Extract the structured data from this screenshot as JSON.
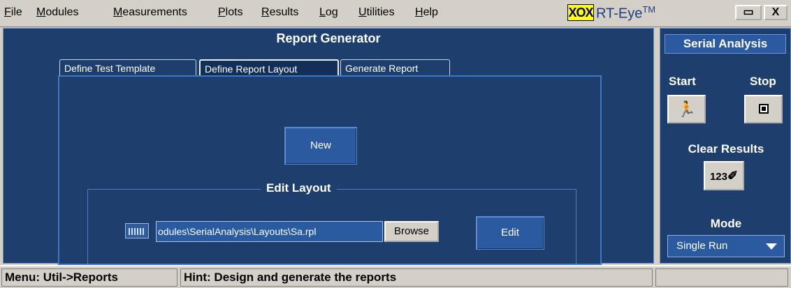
{
  "menu": [
    {
      "pre": "",
      "ul": "F",
      "post": "ile"
    },
    {
      "pre": "",
      "ul": "M",
      "post": "odules"
    },
    {
      "pre": "",
      "ul": "M",
      "post": "easurements"
    },
    {
      "pre": "",
      "ul": "P",
      "post": "lots"
    },
    {
      "pre": "",
      "ul": "R",
      "post": "esults"
    },
    {
      "pre": "",
      "ul": "L",
      "post": "og"
    },
    {
      "pre": "",
      "ul": "U",
      "post": "tilities"
    },
    {
      "pre": "",
      "ul": "H",
      "post": "elp"
    }
  ],
  "app": {
    "logo": "XOX",
    "name": "RT-Eye",
    "tm": "TM",
    "min_label": "▭",
    "close_label": "X"
  },
  "main": {
    "title": "Report Generator",
    "tabs": [
      "Define Test Template",
      "Define Report Layout",
      "Generate Report"
    ],
    "active_tab": "Define Report Layout",
    "new_label": "New",
    "edit_layout_title": "Edit Layout",
    "path_value": "odules\\SerialAnalysis\\Layouts\\Sa.rpl",
    "browse_label": "Browse",
    "edit_label": "Edit"
  },
  "side": {
    "header": "Serial Analysis",
    "start_label": "Start",
    "stop_label": "Stop",
    "start_icon": "running-man-icon",
    "stop_icon": "stop-square-icon",
    "clear_label": "Clear Results",
    "clear_icon_text": "123",
    "mode_label": "Mode",
    "mode_value": "Single Run"
  },
  "status": {
    "menu_path": "Menu: Util->Reports",
    "hint": "Hint: Design and generate the reports"
  },
  "colors": {
    "panel": "#1e3f6d",
    "button": "#2b5aa0",
    "chrome": "#d4d0c8"
  }
}
